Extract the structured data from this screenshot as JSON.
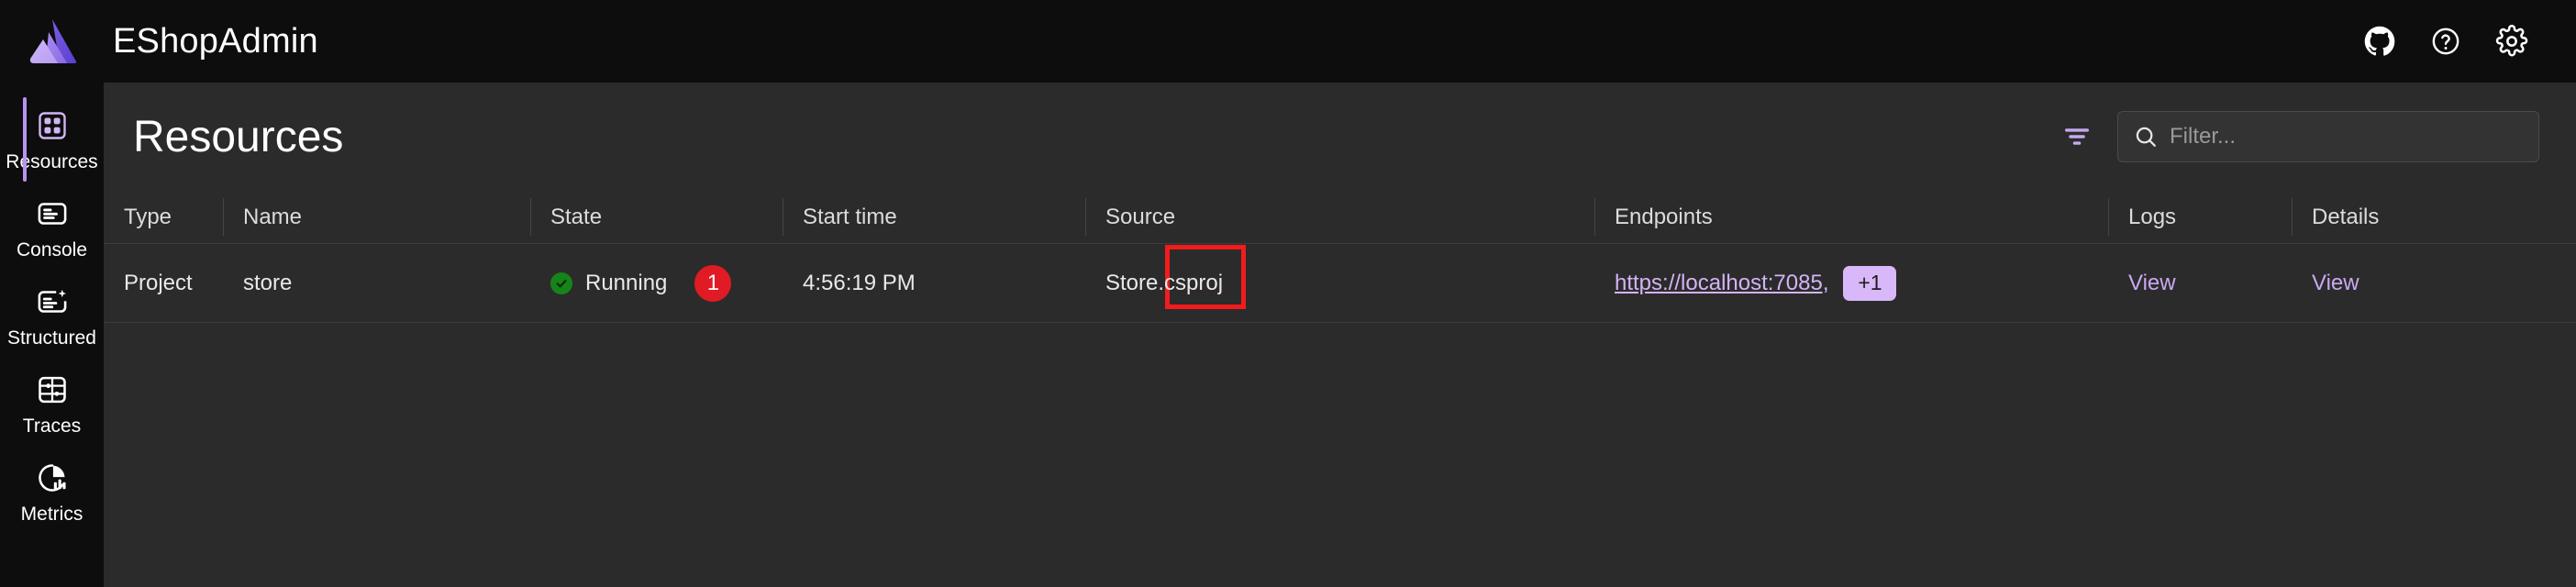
{
  "app": {
    "title": "EShopAdmin",
    "logo_icon": "aspire-logo-icon"
  },
  "topbar": {
    "actions": [
      {
        "icon": "github-icon",
        "label": "GitHub"
      },
      {
        "icon": "help-icon",
        "label": "Help"
      },
      {
        "icon": "settings-gear-icon",
        "label": "Settings"
      }
    ]
  },
  "sidebar": {
    "items": [
      {
        "label": "Resources",
        "icon": "grid-2x2-icon",
        "active": true
      },
      {
        "label": "Console",
        "icon": "console-document-icon",
        "active": false
      },
      {
        "label": "Structured",
        "icon": "structured-sparkle-icon",
        "active": false
      },
      {
        "label": "Traces",
        "icon": "traces-gantt-icon",
        "active": false
      },
      {
        "label": "Metrics",
        "icon": "metrics-pie-chart-icon",
        "active": false
      }
    ]
  },
  "page": {
    "title": "Resources"
  },
  "toolbar": {
    "filter_icon": "filter-funnel-icon",
    "search_icon": "search-magnifier-icon",
    "search_placeholder": "Filter...",
    "search_value": ""
  },
  "table": {
    "columns": [
      "Type",
      "Name",
      "State",
      "Start time",
      "Source",
      "Endpoints",
      "Logs",
      "Details"
    ],
    "rows": [
      {
        "type": "Project",
        "name": "store",
        "state": {
          "status_icon": "green-check-circle-icon",
          "label": "Running",
          "badge_count": "1"
        },
        "start_time": "4:56:19 PM",
        "source": "Store.csproj",
        "endpoints": {
          "url": "https://localhost:7085,",
          "more": "+1"
        },
        "logs": "View",
        "details": "View"
      }
    ]
  },
  "annotation": {
    "type": "highlight-rectangle",
    "color": "#f31b1b"
  },
  "colors": {
    "accent_purple": "#b694f0",
    "link_purple": "#d4b3f7",
    "status_green": "#17841a",
    "badge_red": "#e01b24",
    "sidebar_bg": "#0d0d0d",
    "content_bg": "#2b2b2b"
  }
}
